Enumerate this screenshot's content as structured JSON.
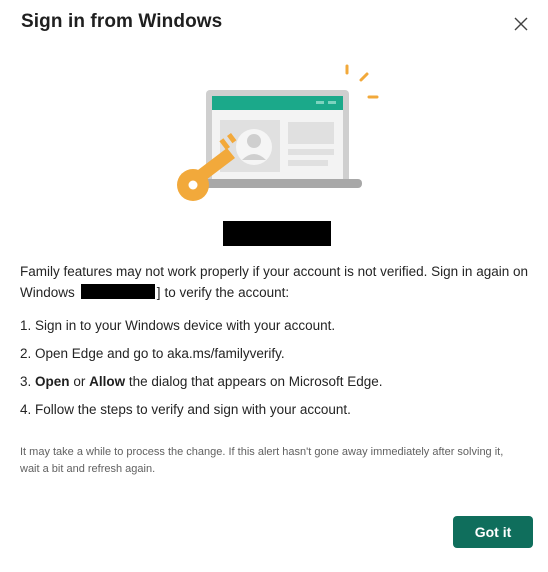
{
  "dialog": {
    "title": "Sign in from Windows",
    "close_icon": "close-icon",
    "description_part1": "Family features may not work properly if your account is not verified. Sign in again on Windows",
    "description_bracket": "]",
    "description_part2": "to verify the account:",
    "steps": [
      {
        "number": "1.",
        "text": "Sign in to your Windows device with your account."
      },
      {
        "number": "2.",
        "text": "Open Edge and go to aka.ms/familyverify."
      },
      {
        "number": "3.",
        "bold1": "Open",
        "mid": "or",
        "bold2": "Allow",
        "rest": "the dialog that appears on Microsoft Edge."
      },
      {
        "number": "4.",
        "text": "Follow the steps to verify and sign with your account."
      }
    ],
    "note": "It may take a while to process the change. If this alert hasn't gone away immediately after solving it, wait a bit and refresh again.",
    "got_it_label": "Got it"
  },
  "colors": {
    "accent": "#0f6e5c",
    "laptop_header": "#1ba98a",
    "key": "#f2a93b"
  }
}
